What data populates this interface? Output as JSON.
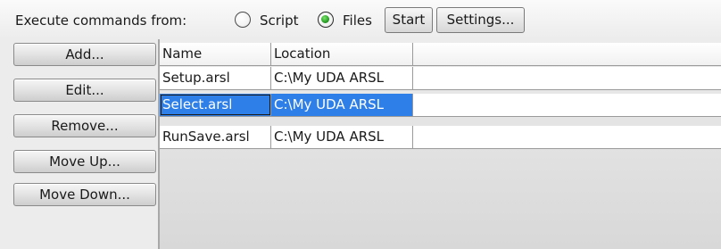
{
  "toolbar": {
    "label": "Execute commands from:",
    "script_option": "Script",
    "files_option": "Files",
    "start_button": "Start",
    "settings_button": "Settings..."
  },
  "sidebar": {
    "buttons": [
      "Add...",
      "Edit...",
      "Remove...",
      "Move Up...",
      "Move Down..."
    ]
  },
  "table": {
    "columns": [
      "Name",
      "Location"
    ],
    "rows": [
      {
        "name": "Setup.arsl",
        "location": "C:\\My UDA ARSL"
      },
      {
        "name": "Select.arsl",
        "location": "C:\\My UDA ARSL",
        "selected": true
      },
      {
        "name": "RunSave.arsl",
        "location": "C:\\My UDA ARSL"
      }
    ]
  },
  "colors": {
    "selection": "#2f7fe8",
    "radio_selected": "#2fa52b"
  }
}
